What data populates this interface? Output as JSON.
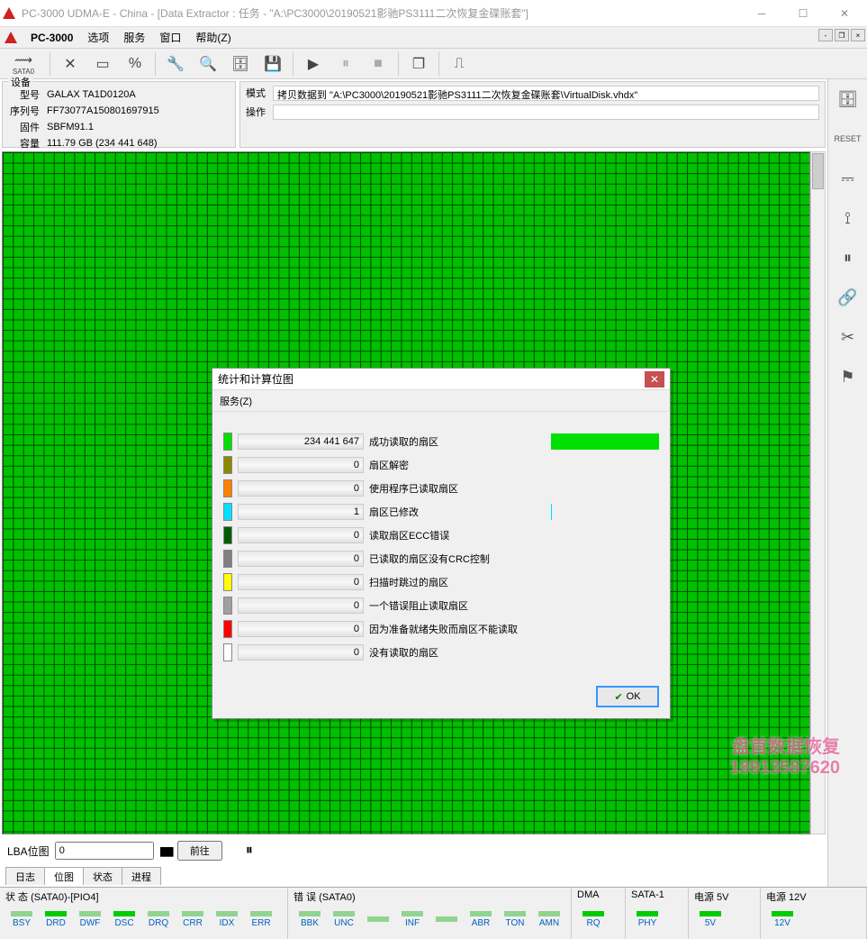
{
  "window": {
    "title": "PC-3000 UDMA-E - China - [Data Extractor : 任务 - \"A:\\PC3000\\20190521影驰PS3111二次恢复金碟账套\"]"
  },
  "menubar": {
    "app": "PC-3000",
    "items": [
      "选项",
      "服务",
      "窗口",
      "帮助(Z)"
    ]
  },
  "toolbar": {
    "sata": "SATA0"
  },
  "device": {
    "legend": "设备",
    "rows": [
      {
        "k": "型号",
        "v": "GALAX TA1D0120A"
      },
      {
        "k": "序列号",
        "v": "FF73077A150801697915"
      },
      {
        "k": "固件",
        "v": "SBFM91.1"
      },
      {
        "k": "容量",
        "v": "111.79 GB (234 441 648)"
      }
    ]
  },
  "mode": {
    "legend_mode": "模式",
    "legend_op": "操作",
    "value": "拷贝数据到 \"A:\\PC3000\\20190521影驰PS3111二次恢复金碟账套\\VirtualDisk.vhdx\"",
    "op": ""
  },
  "lba": {
    "label": "LBA位图",
    "value": "0",
    "go": "前往"
  },
  "bottom_tabs": [
    "日志",
    "位图",
    "状态",
    "进程"
  ],
  "status": {
    "g1": {
      "title": "状 态 (SATA0)-[PIO4]",
      "leds": [
        "BSY",
        "DRD",
        "DWF",
        "DSC",
        "DRQ",
        "CRR",
        "IDX",
        "ERR"
      ]
    },
    "g2": {
      "title": "错 误 (SATA0)",
      "leds": [
        "BBK",
        "UNC",
        "",
        "INF",
        "",
        "ABR",
        "TON",
        "AMN"
      ]
    },
    "g3": {
      "title": "DMA",
      "leds": [
        "RQ"
      ]
    },
    "g4": {
      "title": "SATA-1",
      "leds": [
        "PHY"
      ]
    },
    "g5": {
      "title": "电源 5V",
      "leds": [
        "5V"
      ]
    },
    "g6": {
      "title": "电源 12V",
      "leds": [
        "12V"
      ]
    }
  },
  "dialog": {
    "title": "统计和计算位图",
    "menu": "服务(Z)",
    "ok": "OK",
    "stats": [
      {
        "color": "#00e000",
        "count": "234 441 647",
        "label": "成功读取的扇区",
        "pct": 100,
        "barcolor": "#00e000"
      },
      {
        "color": "#8a8a00",
        "count": "0",
        "label": "扇区解密",
        "pct": 0,
        "barcolor": "#8a8a00"
      },
      {
        "color": "#ff8000",
        "count": "0",
        "label": "使用程序已读取扇区",
        "pct": 0,
        "barcolor": "#ff8000"
      },
      {
        "color": "#00e0ff",
        "count": "1",
        "label": "扇区已修改",
        "pct": 0.5,
        "barcolor": "#00e0ff"
      },
      {
        "color": "#006000",
        "count": "0",
        "label": "读取扇区ECC错误",
        "pct": 0,
        "barcolor": "#006000"
      },
      {
        "color": "#808080",
        "count": "0",
        "label": "已读取的扇区没有CRC控制",
        "pct": 0,
        "barcolor": "#808080"
      },
      {
        "color": "#ffff00",
        "count": "0",
        "label": "扫描时跳过的扇区",
        "pct": 0,
        "barcolor": "#ffff00"
      },
      {
        "color": "#a0a0a0",
        "count": "0",
        "label": "一个错误阻止读取扇区",
        "pct": 0,
        "barcolor": "#a0a0a0"
      },
      {
        "color": "#ff0000",
        "count": "0",
        "label": "因为准备就绪失败而扇区不能读取",
        "pct": 0,
        "barcolor": "#ff0000"
      },
      {
        "color": "#ffffff",
        "count": "0",
        "label": "没有读取的扇区",
        "pct": 0,
        "barcolor": "#ffffff"
      }
    ]
  },
  "watermark": {
    "line1": "盘首数据恢复",
    "line2": "18913587620"
  }
}
